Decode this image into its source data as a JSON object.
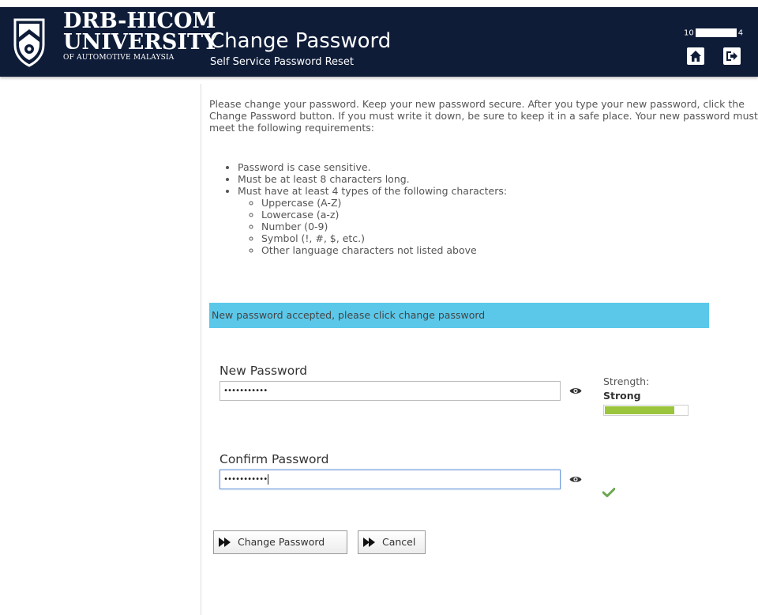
{
  "header": {
    "university_line1": "DRB-HICOM",
    "university_line2": "UNIVERSITY",
    "university_line3": "OF AUTOMOTIVE MALAYSIA",
    "app_title": "Change Password",
    "app_subtitle": "Self Service Password Reset",
    "user_id_prefix": "10",
    "user_id_suffix": "4",
    "home_icon": "home-icon",
    "logout_icon": "logout-icon"
  },
  "intro": {
    "text": "Please change your password. Keep your new password secure. After you type your new password, click the Change Password button. If you must write it down, be sure to keep it in a safe place. Your new password must meet the following requirements:"
  },
  "requirements": {
    "items": [
      "Password is case sensitive.",
      "Must be at least 8 characters long.",
      "Must have at least 4 types of the following characters:"
    ],
    "char_types": [
      "Uppercase (A-Z)",
      "Lowercase (a-z)",
      "Number (0-9)",
      "Symbol (!, #, $, etc.)",
      "Other language characters not listed above"
    ]
  },
  "status_message": "New password accepted, please click change password",
  "new_password": {
    "label": "New Password",
    "value": "•••••••••••",
    "strength_label": "Strength:",
    "strength_value": "Strong",
    "strength_fraction": 0.85,
    "strength_color": "#9bc53d"
  },
  "confirm_password": {
    "label": "Confirm Password",
    "value": "•••••••••••"
  },
  "buttons": {
    "change_password": "Change Password",
    "cancel": "Cancel"
  },
  "colors": {
    "header_bg": "#0e1c38",
    "banner_bg": "#5bc8ea",
    "check_color": "#6aa84f"
  }
}
